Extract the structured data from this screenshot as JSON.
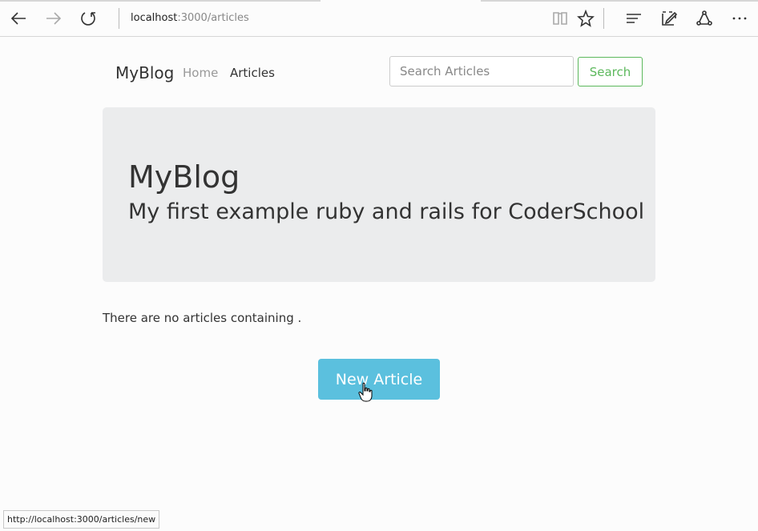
{
  "browser": {
    "address_host": "localhost",
    "address_path": ":3000/articles",
    "status_url": "http://localhost:3000/articles/new"
  },
  "navbar": {
    "brand": "MyBlog",
    "home": "Home",
    "articles": "Articles",
    "search_placeholder": "Search Articles",
    "search_button": "Search"
  },
  "jumbotron": {
    "title": "MyBlog",
    "subtitle": "My first example ruby and rails for CoderSchool"
  },
  "main": {
    "no_results": "There are no articles containing .",
    "new_article_button": "New Article"
  },
  "colors": {
    "success": "#5cb85c",
    "info": "#5bc0de",
    "jumbotron_bg": "#ebeced"
  }
}
